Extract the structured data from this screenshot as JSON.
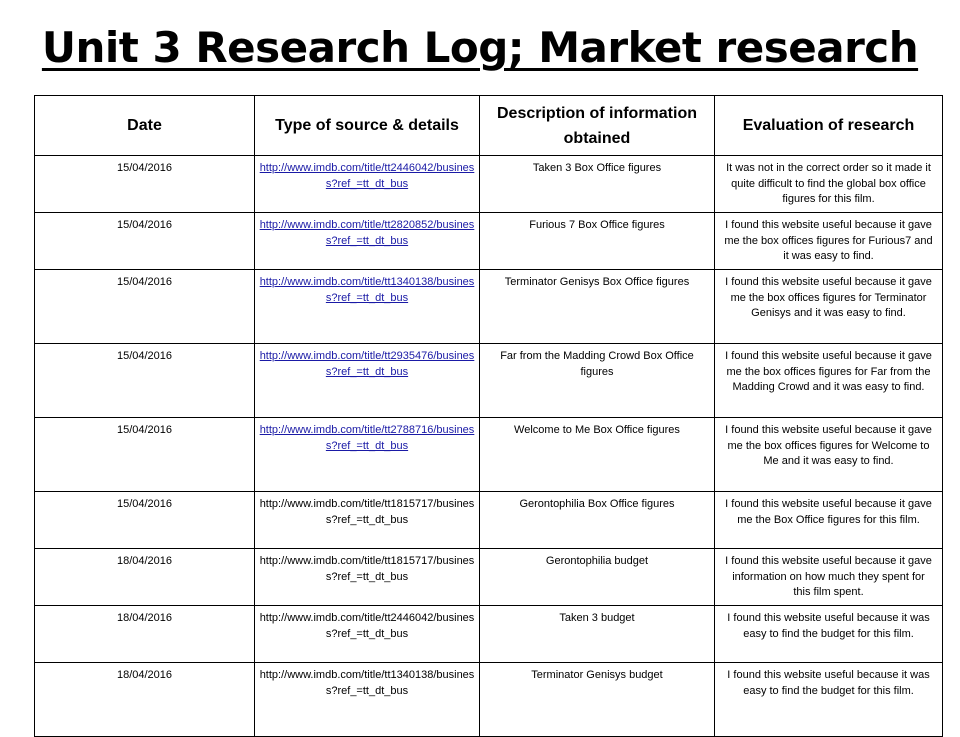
{
  "page": {
    "title": "Unit 3 Research Log;  Market research"
  },
  "table": {
    "headers": [
      "Date",
      "Type of source & details",
      "Description of information obtained",
      "Evaluation of research"
    ],
    "rows": [
      {
        "date": "15/04/2016",
        "source": "http://www.imdb.com/title/tt2446042/business?ref_=tt_dt_bus",
        "source_is_link": true,
        "description": "Taken 3 Box Office figures",
        "evaluation": "It was not in the correct order so it made it quite difficult to find the global box office figures for this film."
      },
      {
        "date": "15/04/2016",
        "source": "http://www.imdb.com/title/tt2820852/business?ref_=tt_dt_bus",
        "source_is_link": true,
        "description": "Furious 7 Box Office figures",
        "evaluation": "I found this website useful because it gave me the box offices figures for Furious7 and it was easy to find."
      },
      {
        "date": "15/04/2016",
        "source": "http://www.imdb.com/title/tt1340138/business?ref_=tt_dt_bus",
        "source_is_link": true,
        "description": "Terminator Genisys Box Office figures",
        "evaluation": "I found this website useful because it gave me the box offices figures for Terminator Genisys and it was easy to find."
      },
      {
        "date": "15/04/2016",
        "source": "http://www.imdb.com/title/tt2935476/business?ref_=tt_dt_bus",
        "source_is_link": true,
        "description": "Far from the Madding Crowd Box Office figures",
        "evaluation": "I found this website useful because it gave me the box offices figures for Far from the Madding Crowd and it was easy to find."
      },
      {
        "date": "15/04/2016",
        "source": "http://www.imdb.com/title/tt2788716/business?ref_=tt_dt_bus",
        "source_is_link": true,
        "description": "Welcome to Me Box Office figures",
        "evaluation": "I found this website useful because it gave me the box offices figures for Welcome to Me and it was easy to find."
      },
      {
        "date": "15/04/2016",
        "source": "http://www.imdb.com/title/tt1815717/business?ref_=tt_dt_bus",
        "source_is_link": false,
        "description": "Gerontophilia Box Office figures",
        "evaluation": "I found this website useful because it gave me the Box Office figures for this film."
      },
      {
        "date": "18/04/2016",
        "source": "http://www.imdb.com/title/tt1815717/business?ref_=tt_dt_bus",
        "source_is_link": false,
        "description": "Gerontophilia budget",
        "evaluation": "I found this website useful because it gave information on how much they spent for this film spent."
      },
      {
        "date": "18/04/2016",
        "source": "http://www.imdb.com/title/tt2446042/business?ref_=tt_dt_bus",
        "source_is_link": false,
        "description": "Taken 3 budget",
        "evaluation": "I found this website useful because it was easy to find the budget for this film."
      },
      {
        "date": "18/04/2016",
        "source": "http://www.imdb.com/title/tt1340138/business?ref_=tt_dt_bus",
        "source_is_link": false,
        "description": "Terminator Genisys budget",
        "evaluation": "I found this website useful because it was easy to find the budget for this film."
      }
    ]
  }
}
